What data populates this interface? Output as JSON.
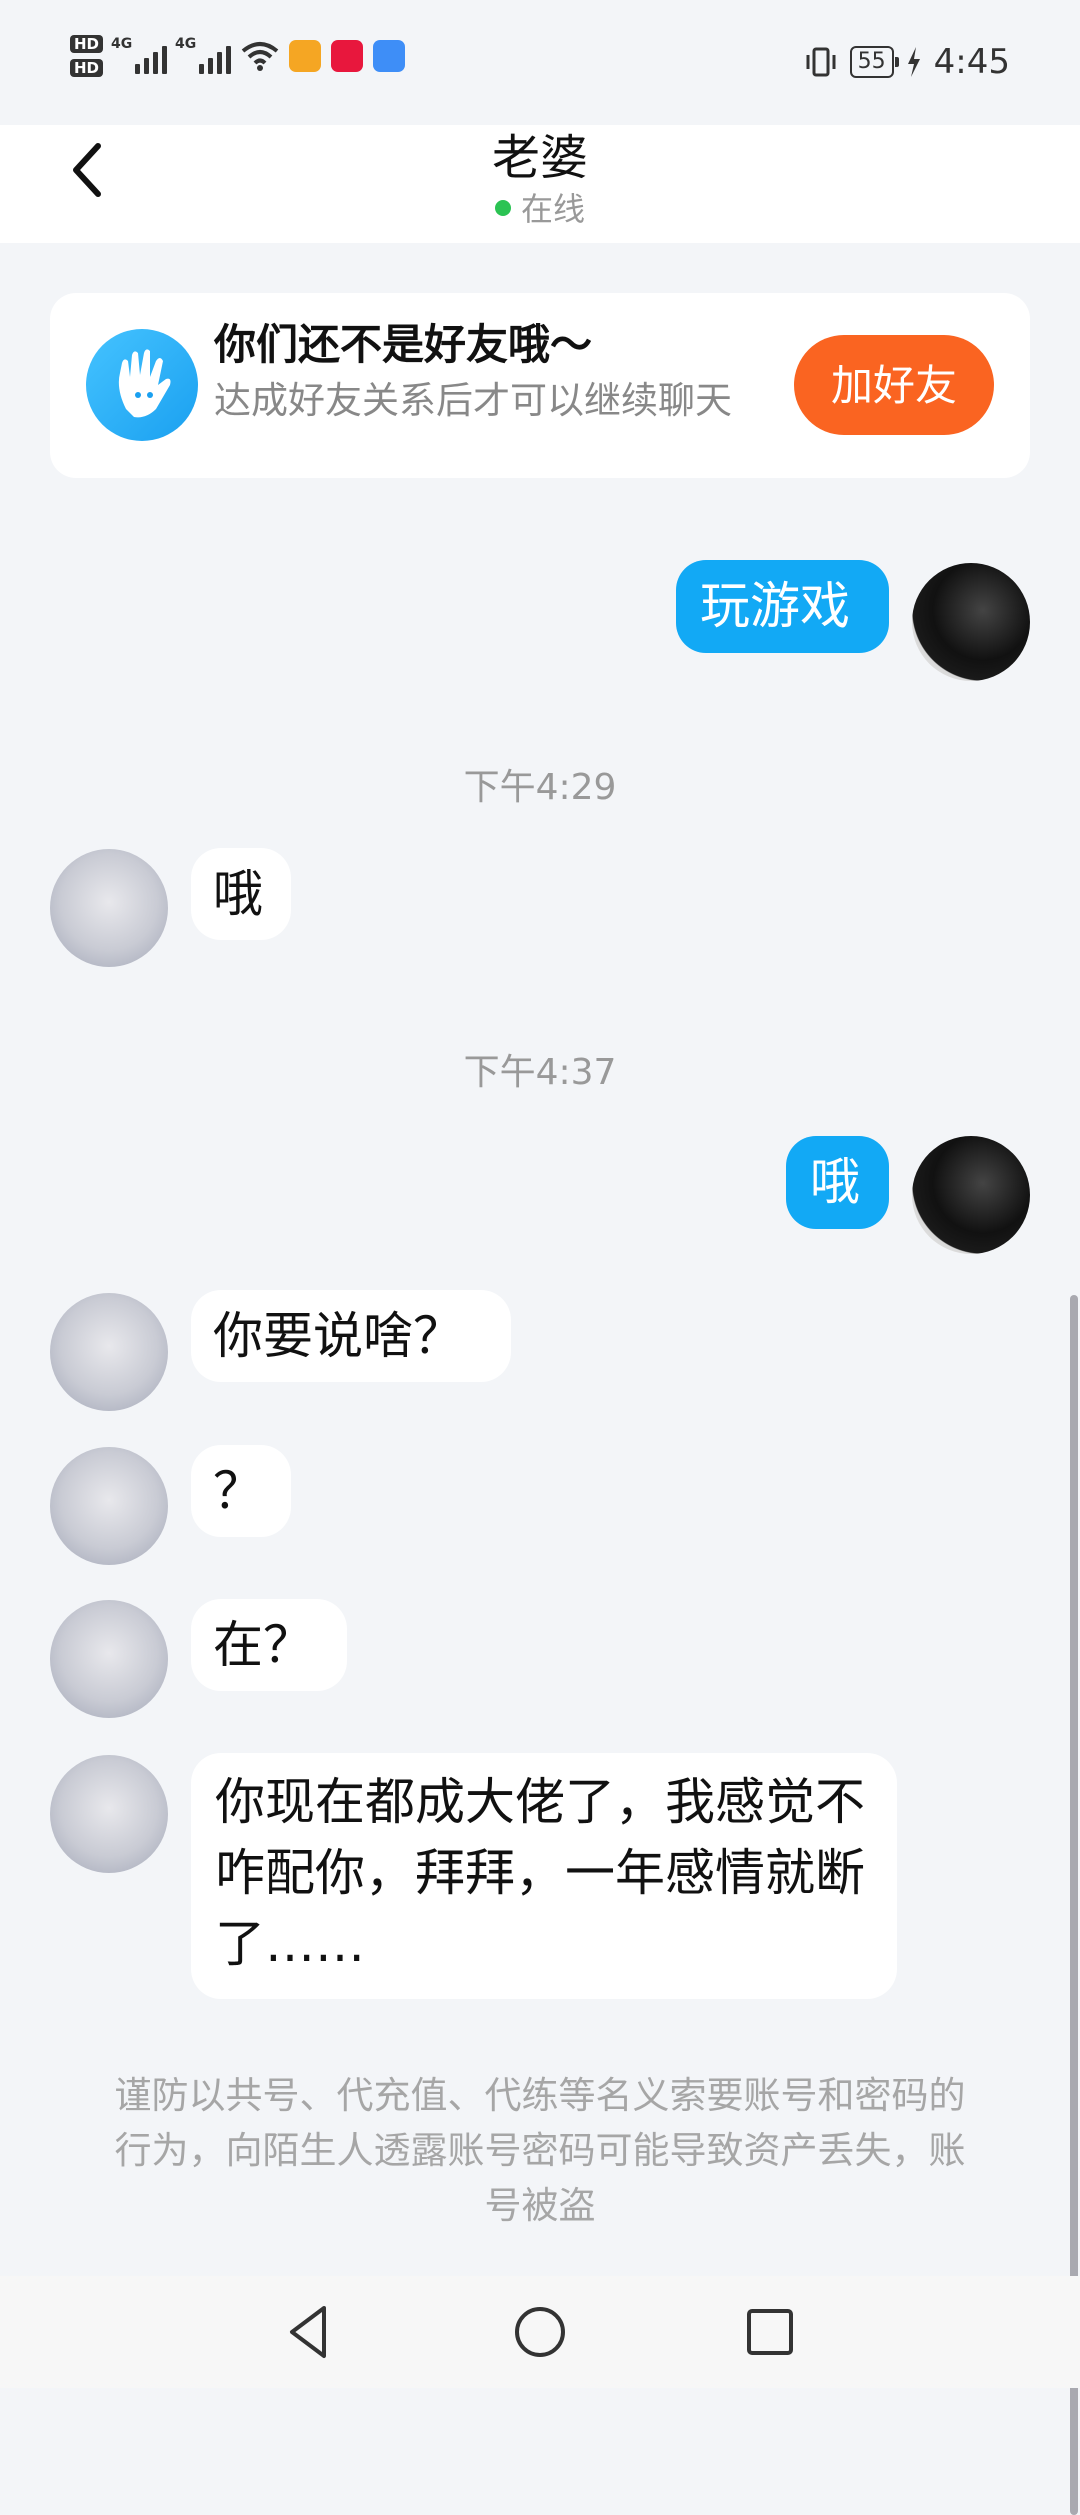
{
  "status_bar": {
    "hd1": "HD",
    "hd2": "HD",
    "net1": "4G",
    "net2": "4G",
    "battery": "55",
    "time": "4:45"
  },
  "header": {
    "title": "老婆",
    "status": "在线"
  },
  "friend_card": {
    "title": "你们还不是好友哦～",
    "subtitle": "达成好友关系后才可以继续聊天",
    "button": "加好友"
  },
  "messages": [
    {
      "side": "me",
      "text": "玩游戏"
    },
    {
      "time": "下午4:29"
    },
    {
      "side": "them",
      "text": "哦"
    },
    {
      "time": "下午4:37"
    },
    {
      "side": "me",
      "text": "哦"
    },
    {
      "side": "them",
      "text": "你要说啥？"
    },
    {
      "side": "them",
      "text": "？"
    },
    {
      "side": "them",
      "text": "在？"
    },
    {
      "side": "them",
      "text": "你现在都成大佬了，我感觉不咋配你，拜拜，一年感情就断了……"
    }
  ],
  "notice": "谨防以共号、代充值、代练等名义索要账号和密码的行为，向陌生人透露账号密码可能导致资产丢失，账号被盗",
  "colors": {
    "accent_blue": "#12a9f5",
    "add_button": "#fa6421",
    "online_dot": "#2bc353"
  }
}
